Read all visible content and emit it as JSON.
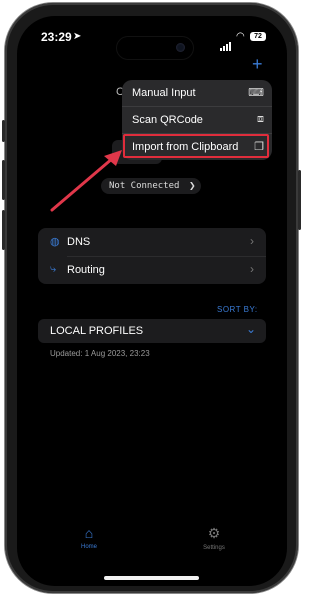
{
  "status_bar": {
    "time": "23:29",
    "location_icon": "location-arrow-icon",
    "battery": "72"
  },
  "header": {
    "add_icon": "plus-icon",
    "add_label": "+",
    "partial_label": "C"
  },
  "menu": {
    "items": [
      {
        "label": "Manual Input",
        "icon": "keyboard-icon",
        "glyph": "⌨"
      },
      {
        "label": "Scan QRCode",
        "icon": "qr-scan-icon",
        "glyph": "⧈"
      },
      {
        "label": "Import from Clipboard",
        "icon": "clipboard-icon",
        "glyph": "❐"
      }
    ],
    "highlight_color": "#e02d3c"
  },
  "connection": {
    "status": "Not Connected",
    "chevron": "❯"
  },
  "settings_group": {
    "items": [
      {
        "label": "DNS",
        "icon": "globe-icon",
        "glyph": "◍",
        "chevron": "›"
      },
      {
        "label": "Routing",
        "icon": "routing-icon",
        "glyph": "⤷",
        "chevron": "›"
      }
    ]
  },
  "profiles": {
    "sort_label": "SORT BY:",
    "section_label": "LOCAL PROFILES",
    "chevron": "⌄",
    "updated": "Updated: 1 Aug 2023, 23:23"
  },
  "tabs": [
    {
      "label": "Home",
      "icon": "home-icon",
      "glyph": "⌂",
      "active": true
    },
    {
      "label": "Settings",
      "icon": "gear-icon",
      "glyph": "⚙",
      "active": false
    }
  ],
  "colors": {
    "accent": "#3a7bd5",
    "annotation": "#e0374a",
    "background": "#000000"
  }
}
